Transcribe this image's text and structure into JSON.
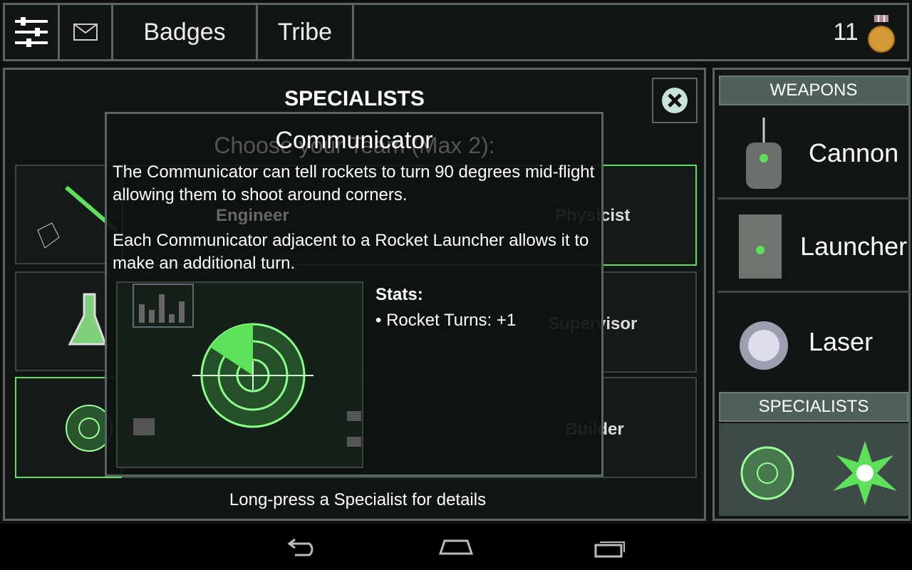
{
  "topbar": {
    "badges_label": "Badges",
    "tribe_label": "Tribe",
    "medal_count": "11",
    "icons": [
      "settings-sliders-icon",
      "mail-icon",
      "medal-icon"
    ]
  },
  "main": {
    "title": "SPECIALISTS",
    "subtitle": "Choose your Team (Max 2):",
    "hint": "Long-press a Specialist for details",
    "specialists": [
      {
        "name": "Engineer"
      },
      {
        "name": "Physicist"
      },
      {
        "name": "Supervisor"
      },
      {
        "name": "Builder"
      }
    ]
  },
  "popup": {
    "title": "Communicator",
    "desc1": "The Communicator can tell rockets to turn 90 degrees mid-flight allowing them to shoot around corners.",
    "desc2": "Each Communicator adjacent to a Rocket Launcher allows it to make an additional turn.",
    "stats_label": "Stats:",
    "stats": [
      "Rocket Turns: +1"
    ]
  },
  "side": {
    "weapons_label": "WEAPONS",
    "weapons": [
      {
        "name": "Cannon"
      },
      {
        "name": "Launcher"
      },
      {
        "name": "Laser"
      }
    ],
    "specialists_label": "SPECIALISTS"
  },
  "colors": {
    "accent": "#5de05a",
    "border": "#5a6663",
    "header": "#4f5f5a"
  }
}
